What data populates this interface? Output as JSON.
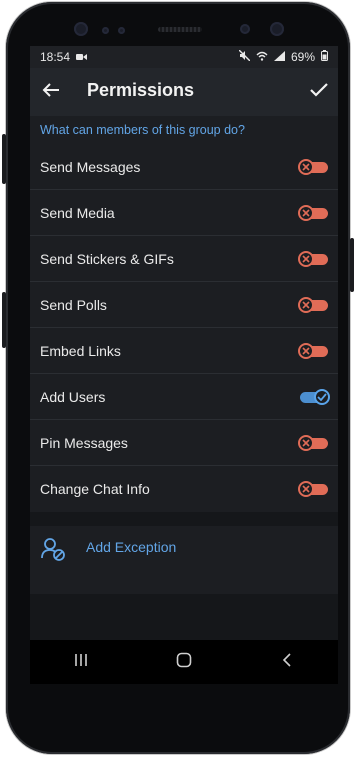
{
  "status_bar": {
    "time": "18:54",
    "battery_percent": "69%",
    "icons": [
      "video-icon",
      "mute-icon",
      "wifi-icon",
      "signal-icon",
      "battery-icon"
    ]
  },
  "app_bar": {
    "title": "Permissions",
    "back_icon": "arrow-left-icon",
    "confirm_icon": "checkmark-icon"
  },
  "section": {
    "header": "What can members of this group do?"
  },
  "permissions": [
    {
      "label": "Send Messages",
      "enabled": false
    },
    {
      "label": "Send Media",
      "enabled": false
    },
    {
      "label": "Send Stickers & GIFs",
      "enabled": false
    },
    {
      "label": "Send Polls",
      "enabled": false
    },
    {
      "label": "Embed Links",
      "enabled": false
    },
    {
      "label": "Add Users",
      "enabled": true
    },
    {
      "label": "Pin Messages",
      "enabled": false
    },
    {
      "label": "Change Chat Info",
      "enabled": false
    }
  ],
  "exception": {
    "label": "Add Exception",
    "icon": "user-block-icon"
  },
  "nav_bar": {
    "icons": [
      "recents-icon",
      "home-icon",
      "back-icon"
    ]
  },
  "colors": {
    "accent": "#62a5e6",
    "toggle_off": "#e06c57",
    "toggle_on": "#4c8fd0",
    "background": "#1c1e22"
  }
}
